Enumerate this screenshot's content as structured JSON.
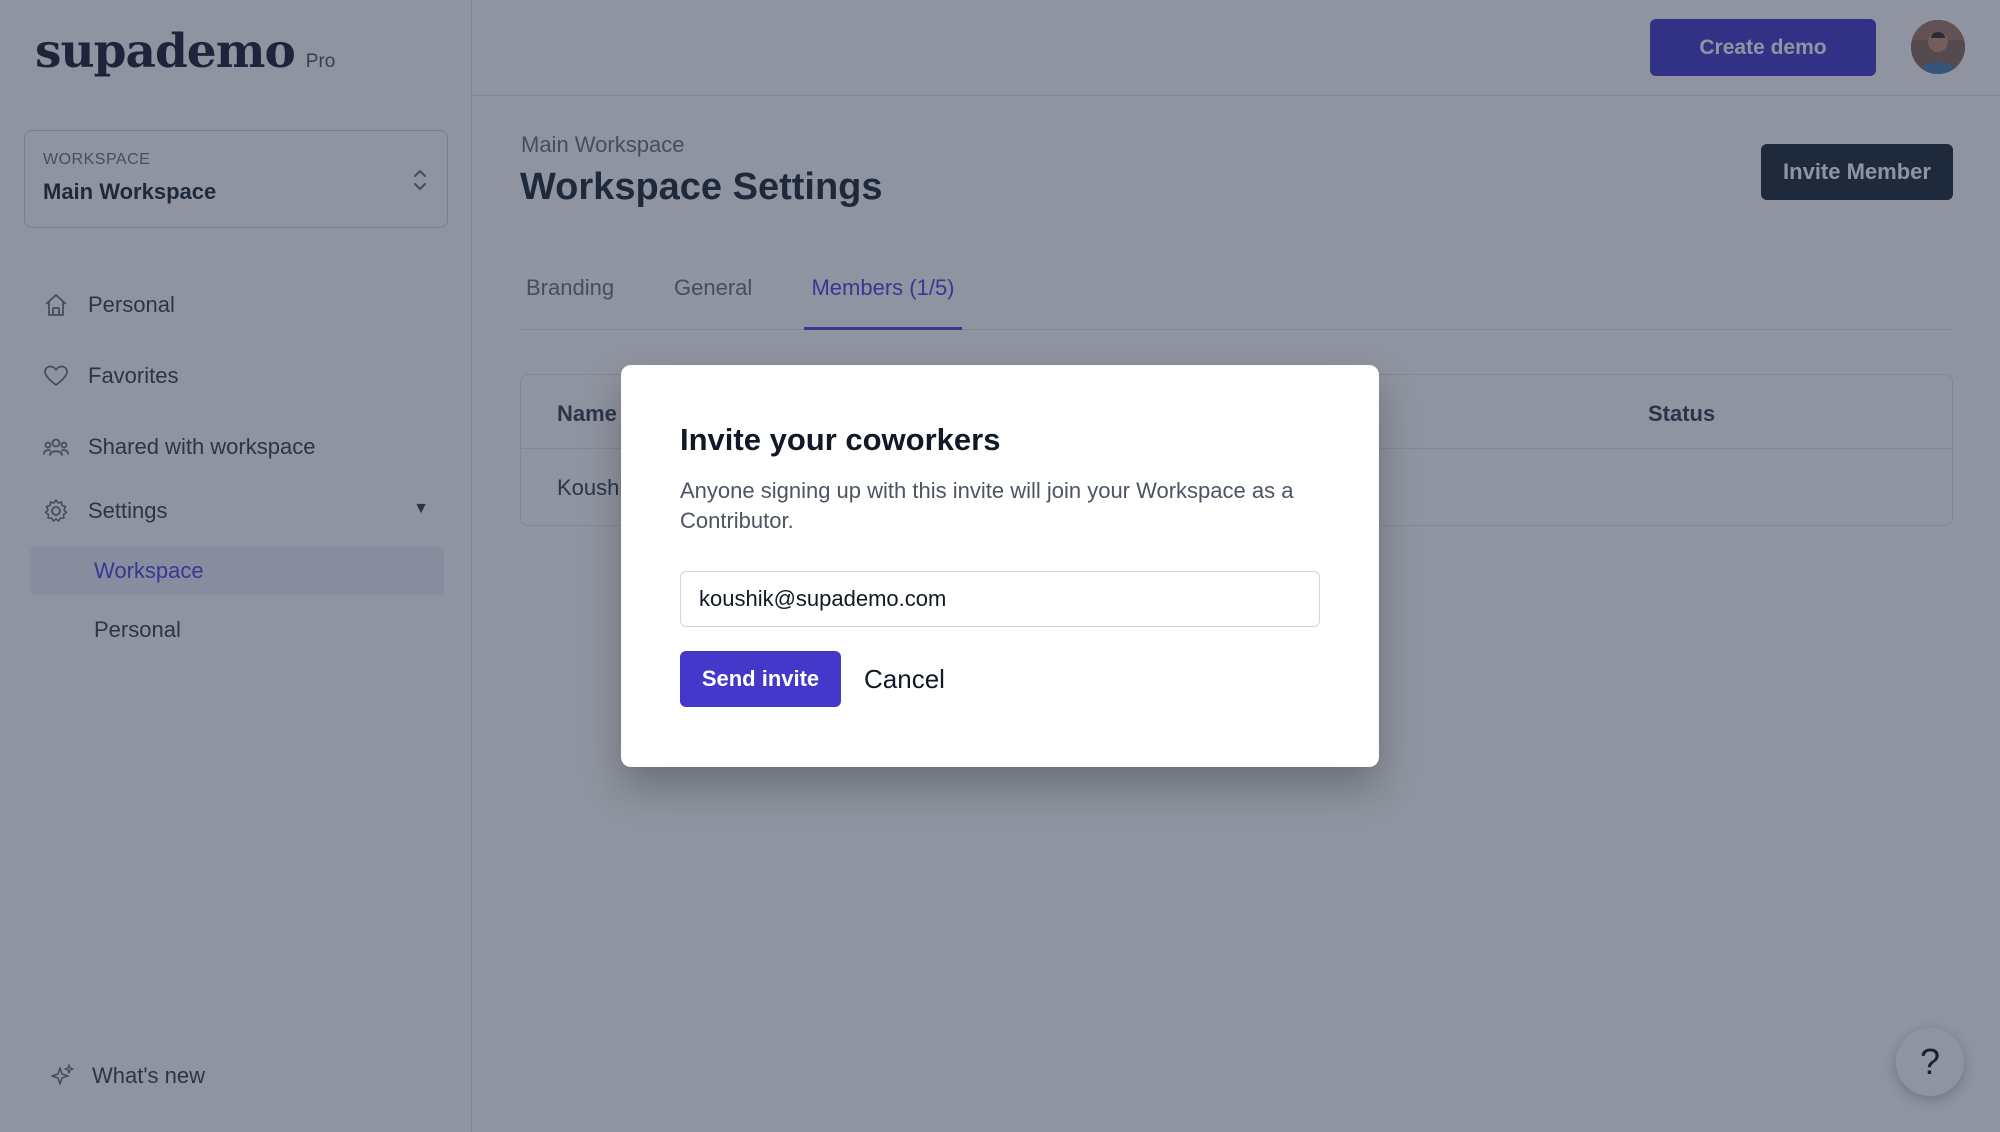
{
  "app": {
    "logo_text": "supademo",
    "plan_badge": "Pro"
  },
  "sidebar": {
    "workspace_switcher": {
      "caption": "WORKSPACE",
      "value": "Main Workspace"
    },
    "items": [
      {
        "label": "Personal",
        "icon": "home-icon"
      },
      {
        "label": "Favorites",
        "icon": "heart-icon"
      },
      {
        "label": "Shared with workspace",
        "icon": "users-icon"
      },
      {
        "label": "Settings",
        "icon": "gear-icon"
      }
    ],
    "settings_caret": "▼",
    "settings_sub": [
      {
        "label": "Workspace",
        "active": true
      },
      {
        "label": "Personal",
        "active": false
      }
    ],
    "whats_new": {
      "label": "What's new",
      "icon": "sparkle-icon"
    }
  },
  "topbar": {
    "create_button": "Create demo",
    "avatar": "user-avatar"
  },
  "main": {
    "breadcrumb": "Main Workspace",
    "title": "Workspace Settings",
    "invite_button": "Invite Member",
    "tabs": [
      {
        "label": "Branding",
        "active": false
      },
      {
        "label": "General",
        "active": false
      },
      {
        "label": "Members (1/5)",
        "active": true
      }
    ],
    "table": {
      "columns": [
        "Name",
        "Status"
      ],
      "rows": [
        {
          "name": "Koushi",
          "status": ""
        }
      ]
    }
  },
  "help_button": "?",
  "modal": {
    "title": "Invite your coworkers",
    "description": "Anyone signing up with this invite will join your Workspace as a Contributor.",
    "email_value": "koushik@supademo.com",
    "send_button": "Send invite",
    "cancel_button": "Cancel"
  },
  "colors": {
    "accent": "#4338ca",
    "accent_text": "#4f46e5",
    "dark_button": "#1f2937",
    "overlay": "#1f2941"
  }
}
